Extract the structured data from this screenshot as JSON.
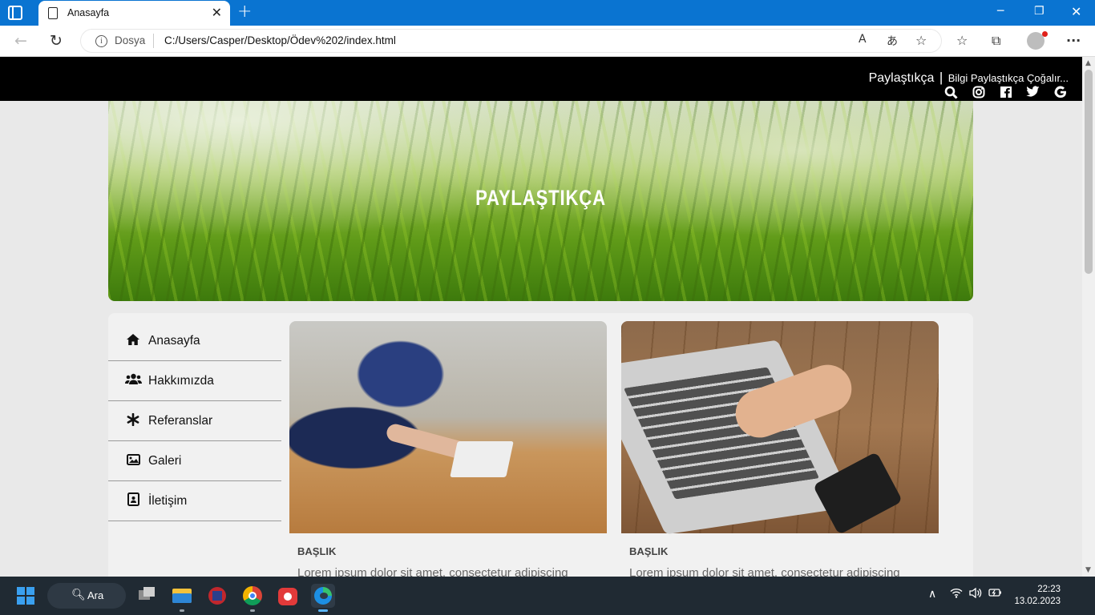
{
  "browser": {
    "tab_title": "Anasayfa",
    "new_tab": "+",
    "url_scheme_label": "Dosya",
    "url": "C:/Users/Casper/Desktop/Ödev%202/index.html",
    "read_aloud": "A",
    "translate": "あ"
  },
  "site": {
    "brand_name": "Paylaştıkça",
    "brand_sep": "|",
    "slogan": "Bilgi Paylaştıkça Çoğalır...",
    "social_icons": [
      "search-icon",
      "instagram-icon",
      "facebook-icon",
      "twitter-icon",
      "google-icon"
    ],
    "hero_title": "PAYLAŞTIKÇA",
    "menu": [
      {
        "label": "Anasayfa",
        "icon": "home-icon"
      },
      {
        "label": "Hakkımızda",
        "icon": "users-icon"
      },
      {
        "label": "Referanslar",
        "icon": "asterisk-icon"
      },
      {
        "label": "Galeri",
        "icon": "image-icon"
      },
      {
        "label": "İletişim",
        "icon": "contact-card-icon"
      }
    ],
    "cards": [
      {
        "title": "BAŞLIK",
        "text": "Lorem ipsum dolor sit amet, consectetur adipiscing"
      },
      {
        "title": "BAŞLIK",
        "text": "Lorem ipsum dolor sit amet, consectetur adipiscing"
      }
    ]
  },
  "taskbar": {
    "search_label": "Ara",
    "time": "22:23",
    "date": "13.02.2023"
  },
  "colors": {
    "titlebar": "#0a74d1",
    "site_topbar": "#000000",
    "taskbar": "#202a33"
  }
}
